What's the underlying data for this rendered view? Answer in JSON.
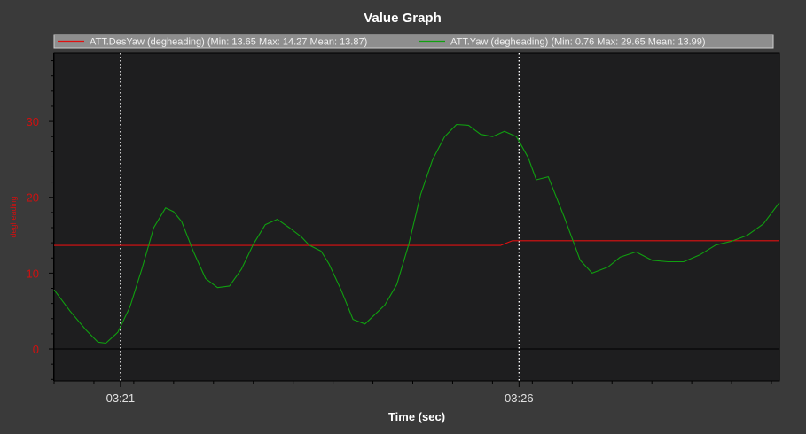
{
  "chart_data": {
    "type": "line",
    "title": "Value Graph",
    "xlabel": "Time (sec)",
    "ylabel": "degheading",
    "xlim": [
      0,
      9.1
    ],
    "ylim": [
      -4.2,
      39
    ],
    "x_ticks": [
      {
        "value": 0.833,
        "label": "03:21"
      },
      {
        "value": 5.833,
        "label": "03:26"
      }
    ],
    "y_ticks": [
      0,
      10,
      20,
      30
    ],
    "series": [
      {
        "name": "ATT.DesYaw (degheading)",
        "legend_label": "ATT.DesYaw (degheading)  (Min: 13.65 Max: 14.27 Mean: 13.87)",
        "color": "#e01010",
        "x": [
          0,
          5.6,
          5.75,
          9.1
        ],
        "y": [
          13.65,
          13.65,
          14.27,
          14.27
        ]
      },
      {
        "name": "ATT.Yaw (degheading)",
        "legend_label": "ATT.Yaw (degheading)  (Min: 0.76 Max: 29.65 Mean: 13.99)",
        "color": "#10a010",
        "x": [
          0,
          0.2,
          0.4,
          0.55,
          0.65,
          0.8,
          0.95,
          1.1,
          1.25,
          1.4,
          1.5,
          1.6,
          1.75,
          1.9,
          2.05,
          2.2,
          2.35,
          2.5,
          2.65,
          2.8,
          2.95,
          3.1,
          3.2,
          3.35,
          3.45,
          3.6,
          3.75,
          3.9,
          4.0,
          4.15,
          4.3,
          4.45,
          4.6,
          4.75,
          4.9,
          5.05,
          5.2,
          5.35,
          5.5,
          5.65,
          5.8,
          5.95,
          6.05,
          6.2,
          6.4,
          6.6,
          6.75,
          6.95,
          7.1,
          7.3,
          7.5,
          7.7,
          7.9,
          8.1,
          8.3,
          8.5,
          8.7,
          8.9,
          9.1
        ],
        "y": [
          7.8,
          5.0,
          2.5,
          0.9,
          0.76,
          2.2,
          5.5,
          10.5,
          16.0,
          18.6,
          18.1,
          16.8,
          12.8,
          9.3,
          8.1,
          8.3,
          10.5,
          13.8,
          16.4,
          17.1,
          16.0,
          14.8,
          13.7,
          12.9,
          11.2,
          7.8,
          3.9,
          3.3,
          4.3,
          5.8,
          8.5,
          13.8,
          20.4,
          25.0,
          28.0,
          29.6,
          29.5,
          28.3,
          28.0,
          28.7,
          28.0,
          25.2,
          22.3,
          22.7,
          17.4,
          11.7,
          10.0,
          10.8,
          12.1,
          12.8,
          11.7,
          11.5,
          11.5,
          12.4,
          13.7,
          14.2,
          15.0,
          16.5,
          19.3
        ]
      }
    ],
    "grid": false,
    "vertical_markers": [
      0.833,
      5.833
    ],
    "zero_line": 0,
    "legend_position": "top",
    "colors": {
      "background": "#3a3a3a",
      "plot_background": "#1e1e1f",
      "axis_text": "#e0e0e0",
      "y_tick_text": "#d01010",
      "legend_background": "#8e8e8e"
    }
  }
}
